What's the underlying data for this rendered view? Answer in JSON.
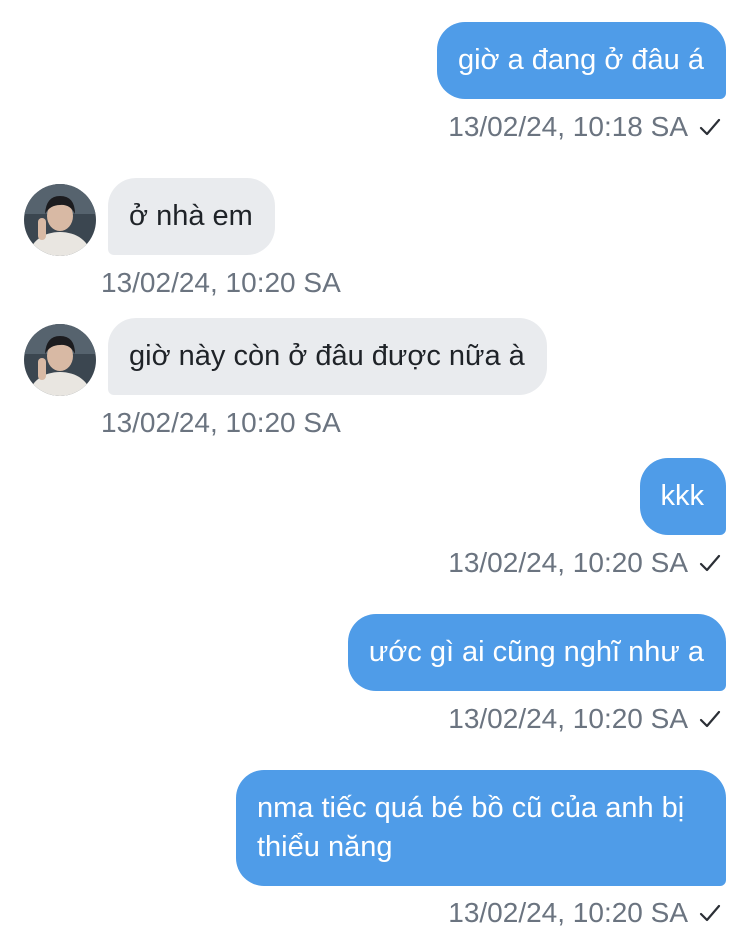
{
  "messages": [
    {
      "direction": "out",
      "text": "giờ a đang ở đâu á",
      "time": "13/02/24, 10:18 SA",
      "read_icon": "check-icon"
    },
    {
      "direction": "in",
      "text": "ở nhà em",
      "time": "13/02/24, 10:20 SA",
      "avatar_icon": "contact-avatar"
    },
    {
      "direction": "in",
      "text": "giờ này còn ở đâu được nữa à",
      "time": "13/02/24, 10:20 SA",
      "avatar_icon": "contact-avatar"
    },
    {
      "direction": "out",
      "text": "kkk",
      "time": "13/02/24, 10:20 SA",
      "read_icon": "check-icon"
    },
    {
      "direction": "out",
      "text": "ước gì ai cũng nghĩ như a",
      "time": "13/02/24, 10:20 SA",
      "read_icon": "check-icon"
    },
    {
      "direction": "out",
      "text": "nma tiếc quá bé bồ cũ của anh bị thiểu năng",
      "time": "13/02/24, 10:20 SA",
      "read_icon": "check-icon"
    }
  ],
  "colors": {
    "outgoing_bubble": "#4f9ce8",
    "incoming_bubble": "#e9ebee",
    "timestamp": "#6b7480"
  }
}
